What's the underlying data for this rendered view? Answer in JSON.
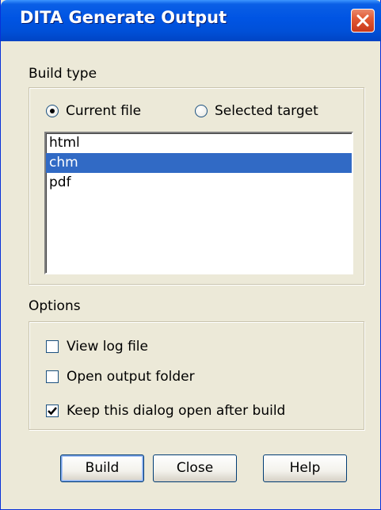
{
  "window": {
    "title": "DITA Generate Output"
  },
  "build_type": {
    "label": "Build type",
    "radio_current": "Current file",
    "radio_selected": "Selected target",
    "selected_radio": "Current file",
    "list_items": [
      "html",
      "chm",
      "pdf"
    ],
    "selected_item": "chm"
  },
  "options": {
    "label": "Options",
    "view_log": {
      "label": "View log file",
      "checked": false
    },
    "open_folder": {
      "label": "Open output folder",
      "checked": false
    },
    "keep_open": {
      "label": "Keep this dialog open after build",
      "checked": true
    }
  },
  "buttons": {
    "build": "Build",
    "close": "Close",
    "help": "Help"
  },
  "colors": {
    "title_bar": "#0054e3",
    "selection": "#316ac5",
    "dialog_bg": "#ece9d8"
  },
  "icons": {
    "close": "close-icon"
  }
}
